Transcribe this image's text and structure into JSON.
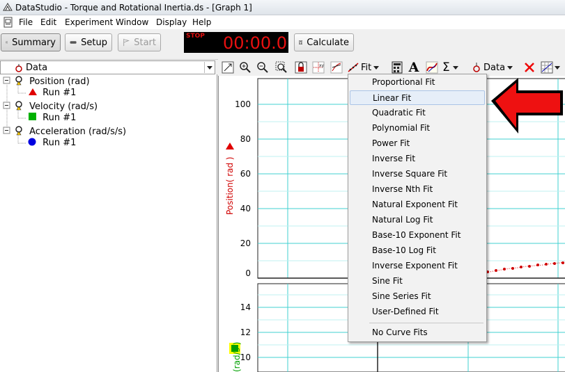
{
  "window": {
    "title": "DataStudio - Torque and Rotational Inertia.ds - [Graph 1]"
  },
  "menubar": {
    "items": [
      "File",
      "Edit",
      "Experiment",
      "Window",
      "Display",
      "Help"
    ]
  },
  "toolbar": {
    "summary": "Summary",
    "setup": "Setup",
    "start": "Start",
    "timer_stop": "STOP",
    "timer": "00:00.0",
    "calculate": "Calculate"
  },
  "data_panel": {
    "header": "Data",
    "tree": [
      {
        "label": "Position (rad)",
        "run": "Run #1"
      },
      {
        "label": "Velocity (rad/s)",
        "run": "Run #1"
      },
      {
        "label": "Acceleration (rad/s/s)",
        "run": "Run #1"
      }
    ]
  },
  "graph_toolbar": {
    "fit": "Fit",
    "data": "Data"
  },
  "fit_menu": {
    "items": [
      "Proportional Fit",
      "Linear Fit",
      "Quadratic Fit",
      "Polynomial Fit",
      "Power Fit",
      "Inverse Fit",
      "Inverse Square Fit",
      "Inverse Nth Fit",
      "Natural Exponent Fit",
      "Natural Log Fit",
      "Base-10 Exponent Fit",
      "Base-10 Log Fit",
      "Inverse Exponent Fit",
      "Sine Fit",
      "Sine Series Fit",
      "User-Defined Fit"
    ],
    "highlighted": "Linear Fit",
    "no_fit": "No Curve Fits"
  },
  "graph_top": {
    "ylabel": "Position( rad )",
    "yticks": [
      "100",
      "80",
      "60",
      "40",
      "20",
      "0"
    ]
  },
  "graph_bottom": {
    "ylabel": "(rad/s )",
    "yticks": [
      "14",
      "12",
      "10"
    ]
  },
  "colors": {
    "position": "#e00000",
    "velocity": "#00a000",
    "acceleration": "#0000e0",
    "grid": "#40d0d0",
    "arrow": "#ee1111"
  }
}
